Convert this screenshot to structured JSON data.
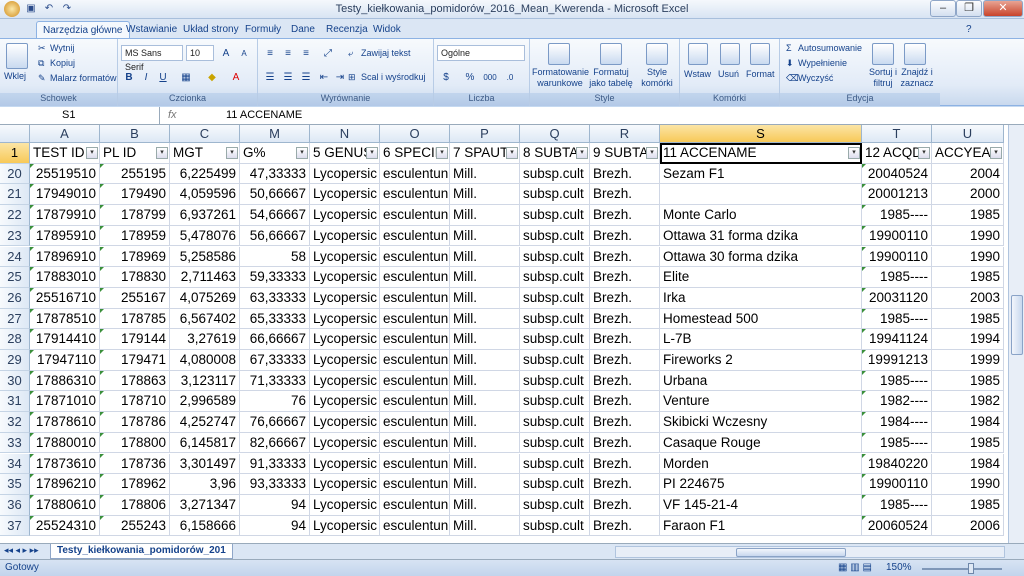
{
  "window": {
    "title": "Testy_kiełkowania_pomidorów_2016_Mean_Kwerenda - Microsoft Excel",
    "buttons": {
      "minimize": "–",
      "restore": "❐",
      "close": "✕"
    }
  },
  "ribbon_tabs": [
    {
      "label": "Narzędzia główne",
      "active": true
    },
    {
      "label": "Wstawianie"
    },
    {
      "label": "Układ strony"
    },
    {
      "label": "Formuły"
    },
    {
      "label": "Dane"
    },
    {
      "label": "Recenzja"
    },
    {
      "label": "Widok"
    }
  ],
  "ribbon": {
    "schowek": {
      "label": "Schowek",
      "paste": "Wklej",
      "cut": "Wytnij",
      "copy": "Kopiuj",
      "painter": "Malarz formatów"
    },
    "czcionka": {
      "label": "Czcionka",
      "font": "MS Sans Serif",
      "size": "10",
      "bold": "B",
      "italic": "I",
      "underline": "U"
    },
    "wyrownanie": {
      "label": "Wyrównanie",
      "wrap": "Zawijaj tekst",
      "merge": "Scal i wyśrodkuj"
    },
    "liczba": {
      "label": "Liczba",
      "format": "Ogólne",
      "percent": "%",
      "thousands": "000"
    },
    "style": {
      "label": "Style",
      "cond": "Formatowanie warunkowe",
      "table": "Formatuj jako tabelę",
      "cell": "Style komórki"
    },
    "komorki": {
      "label": "Komórki",
      "insert": "Wstaw",
      "delete": "Usuń",
      "format": "Format"
    },
    "edycja": {
      "label": "Edycja",
      "autosum": "Autosumowanie",
      "fill": "Wypełnienie",
      "clear": "Wyczyść",
      "sort": "Sortuj i filtruj",
      "find": "Znajdź i zaznacz"
    }
  },
  "formula_bar": {
    "namebox": "S1",
    "fx": "fx",
    "formula": "11 ACCENAME"
  },
  "columns": [
    {
      "letter": "A",
      "header": "TEST ID"
    },
    {
      "letter": "B",
      "header": "PL ID"
    },
    {
      "letter": "C",
      "header": "MGT"
    },
    {
      "letter": "M",
      "header": "G%"
    },
    {
      "letter": "N",
      "header": "5 GENUS"
    },
    {
      "letter": "O",
      "header": "6 SPECIE"
    },
    {
      "letter": "P",
      "header": "7 SPAUT"
    },
    {
      "letter": "Q",
      "header": "8 SUBTA"
    },
    {
      "letter": "R",
      "header": "9 SUBTA"
    },
    {
      "letter": "S",
      "header": "11 ACCENAME"
    },
    {
      "letter": "T",
      "header": "12 ACQD"
    },
    {
      "letter": "U",
      "header": "ACCYEAR"
    }
  ],
  "header_row_number": "1",
  "rows": [
    {
      "n": "20",
      "cells": [
        "25519510",
        "255195",
        "6,225499",
        "47,33333",
        "Lycopersic",
        "esculentun",
        "Mill.",
        "subsp.cult",
        "Brezh.",
        "Sezam F1",
        "20040524",
        "2004"
      ]
    },
    {
      "n": "21",
      "cells": [
        "17949010",
        "179490",
        "4,059596",
        "50,66667",
        "Lycopersic",
        "esculentun",
        "Mill.",
        "subsp.cult",
        "Brezh.",
        "",
        "20001213",
        "2000"
      ]
    },
    {
      "n": "22",
      "cells": [
        "17879910",
        "178799",
        "6,937261",
        "54,66667",
        "Lycopersic",
        "esculentun",
        "Mill.",
        "subsp.cult",
        "Brezh.",
        "Monte Carlo",
        "1985----",
        "1985"
      ]
    },
    {
      "n": "23",
      "cells": [
        "17895910",
        "178959",
        "5,478076",
        "56,66667",
        "Lycopersic",
        "esculentun",
        "Mill.",
        "subsp.cult",
        "Brezh.",
        "Ottawa 31 forma dzika",
        "19900110",
        "1990"
      ]
    },
    {
      "n": "24",
      "cells": [
        "17896910",
        "178969",
        "5,258586",
        "58",
        "Lycopersic",
        "esculentun",
        "Mill.",
        "subsp.cult",
        "Brezh.",
        "Ottawa 30 forma dzika",
        "19900110",
        "1990"
      ]
    },
    {
      "n": "25",
      "cells": [
        "17883010",
        "178830",
        "2,711463",
        "59,33333",
        "Lycopersic",
        "esculentun",
        "Mill.",
        "subsp.cult",
        "Brezh.",
        "Elite",
        "1985----",
        "1985"
      ]
    },
    {
      "n": "26",
      "cells": [
        "25516710",
        "255167",
        "4,075269",
        "63,33333",
        "Lycopersic",
        "esculentun",
        "Mill.",
        "subsp.cult",
        "Brezh.",
        "Irka",
        "20031120",
        "2003"
      ]
    },
    {
      "n": "27",
      "cells": [
        "17878510",
        "178785",
        "6,567402",
        "65,33333",
        "Lycopersic",
        "esculentun",
        "Mill.",
        "subsp.cult",
        "Brezh.",
        "Homestead 500",
        "1985----",
        "1985"
      ]
    },
    {
      "n": "28",
      "cells": [
        "17914410",
        "179144",
        "3,27619",
        "66,66667",
        "Lycopersic",
        "esculentun",
        "Mill.",
        "subsp.cult",
        "Brezh.",
        "L-7B",
        "19941124",
        "1994"
      ]
    },
    {
      "n": "29",
      "cells": [
        "17947110",
        "179471",
        "4,080008",
        "67,33333",
        "Lycopersic",
        "esculentun",
        "Mill.",
        "subsp.cult",
        "Brezh.",
        "Fireworks 2",
        "19991213",
        "1999"
      ]
    },
    {
      "n": "30",
      "cells": [
        "17886310",
        "178863",
        "3,123117",
        "71,33333",
        "Lycopersic",
        "esculentun",
        "Mill.",
        "subsp.cult",
        "Brezh.",
        "Urbana",
        "1985----",
        "1985"
      ]
    },
    {
      "n": "31",
      "cells": [
        "17871010",
        "178710",
        "2,996589",
        "76",
        "Lycopersic",
        "esculentun",
        "Mill.",
        "subsp.cult",
        "Brezh.",
        "Venture",
        "1982----",
        "1982"
      ]
    },
    {
      "n": "32",
      "cells": [
        "17878610",
        "178786",
        "4,252747",
        "76,66667",
        "Lycopersic",
        "esculentun",
        "Mill.",
        "subsp.cult",
        "Brezh.",
        "Skibicki Wczesny",
        "1984----",
        "1984"
      ]
    },
    {
      "n": "33",
      "cells": [
        "17880010",
        "178800",
        "6,145817",
        "82,66667",
        "Lycopersic",
        "esculentun",
        "Mill.",
        "subsp.cult",
        "Brezh.",
        "Casaque Rouge",
        "1985----",
        "1985"
      ]
    },
    {
      "n": "34",
      "cells": [
        "17873610",
        "178736",
        "3,301497",
        "91,33333",
        "Lycopersic",
        "esculentun",
        "Mill.",
        "subsp.cult",
        "Brezh.",
        "Morden",
        "19840220",
        "1984"
      ]
    },
    {
      "n": "35",
      "cells": [
        "17896210",
        "178962",
        "3,96",
        "93,33333",
        "Lycopersic",
        "esculentun",
        "Mill.",
        "subsp.cult",
        "Brezh.",
        "PI 224675",
        "19900110",
        "1990"
      ]
    },
    {
      "n": "36",
      "cells": [
        "17880610",
        "178806",
        "3,271347",
        "94",
        "Lycopersic",
        "esculentun",
        "Mill.",
        "subsp.cult",
        "Brezh.",
        "VF 145-21-4",
        "1985----",
        "1985"
      ]
    },
    {
      "n": "37",
      "cells": [
        "25524310",
        "255243",
        "6,158666",
        "94",
        "Lycopersic",
        "esculentun",
        "Mill.",
        "subsp.cult",
        "Brezh.",
        "Faraon F1",
        "20060524",
        "2006"
      ]
    }
  ],
  "sheet_tab": "Testy_kiełkowania_pomidorów_201",
  "status": {
    "ready": "Gotowy",
    "zoom": "150%"
  }
}
